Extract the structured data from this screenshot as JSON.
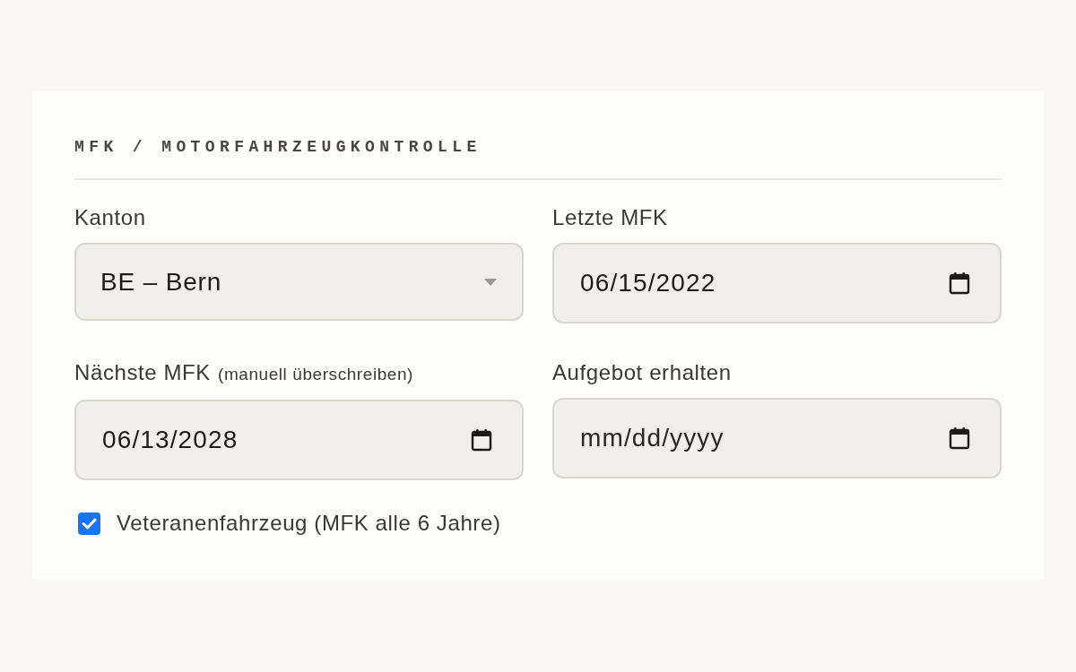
{
  "section": {
    "title": "MFK / MOTORFAHRZEUGKONTROLLE"
  },
  "fields": [
    {
      "kind": "select",
      "label": "Kanton",
      "value": "BE – Bern"
    },
    {
      "kind": "date",
      "label": "Letzte MFK",
      "value": "06/15/2022"
    },
    {
      "kind": "date",
      "label": "Nächste MFK",
      "hint": "(manuell überschreiben)",
      "value": "06/13/2028"
    },
    {
      "kind": "date",
      "label": "Aufgebot erhalten",
      "placeholder": "mm/dd/yyyy"
    }
  ],
  "checkbox": {
    "label": "Veteranenfahrzeug (MFK alle 6 Jahre)",
    "checked": true
  }
}
